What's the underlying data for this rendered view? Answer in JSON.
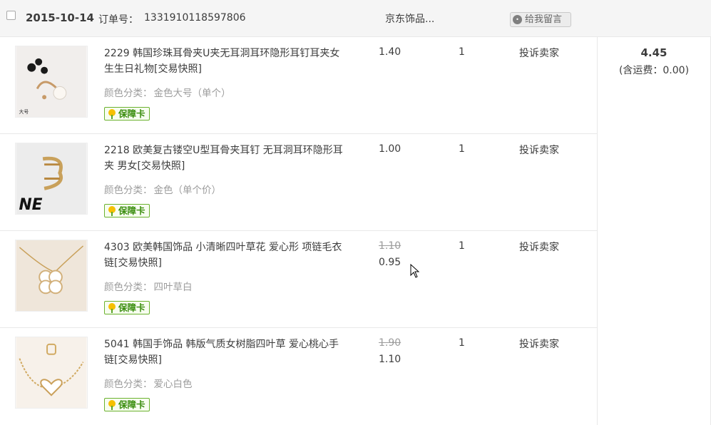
{
  "order": {
    "date": "2015-10-14",
    "order_no_label": "订单号：",
    "order_no": "1331910118597806",
    "shop_name": "京东饰品...",
    "message_button": "给我留言",
    "message_icon": "chat-bubble-icon"
  },
  "items": [
    {
      "title": "2229 韩国珍珠耳骨夹U夹无耳洞耳环隐形耳钉耳夹女生生日礼物[交易快照]",
      "spec_label": "颜色分类：",
      "spec_value": "金色大号（单个）",
      "thumb_caption": "大号",
      "badge": "保障卡",
      "original_price": "",
      "price": "1.40",
      "quantity": "1",
      "complain": "投诉卖家"
    },
    {
      "title": "2218 欧美复古镂空U型耳骨夹耳钉 无耳洞耳环隐形耳夹 男女[交易快照]",
      "spec_label": "颜色分类：",
      "spec_value": "金色（单个价）",
      "thumb_caption": "NE",
      "badge": "保障卡",
      "original_price": "",
      "price": "1.00",
      "quantity": "1",
      "complain": "投诉卖家"
    },
    {
      "title": "4303 欧美韩国饰品 小清晰四叶草花 爱心形 项链毛衣链[交易快照]",
      "spec_label": "颜色分类：",
      "spec_value": "四叶草白",
      "thumb_caption": "",
      "badge": "保障卡",
      "original_price": "1.10",
      "price": "0.95",
      "quantity": "1",
      "complain": "投诉卖家"
    },
    {
      "title": "5041 韩国手饰品 韩版气质女树脂四叶草 爱心桃心手链[交易快照]",
      "spec_label": "颜色分类：",
      "spec_value": "爱心白色",
      "thumb_caption": "",
      "badge": "保障卡",
      "original_price": "1.90",
      "price": "1.10",
      "quantity": "1",
      "complain": "投诉卖家"
    }
  ],
  "total": {
    "amount": "4.45",
    "shipping": "(含运费：0.00)"
  },
  "colors": {
    "header_bg": "#f5f5f5",
    "border": "#e8e8e8",
    "text": "#3c3c3c",
    "muted": "#9c9c9c",
    "badge_green": "#3a8d0e"
  }
}
